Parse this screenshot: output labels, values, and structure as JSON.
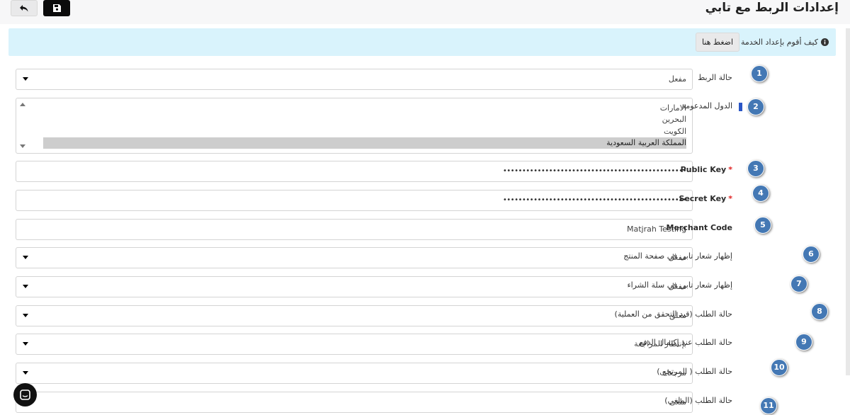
{
  "header": {
    "title": "إعدادات الربط مع تابي",
    "back_icon": "undo-arrow-icon",
    "save_icon": "floppy-disk-icon"
  },
  "info": {
    "text": "كيف أقوم بإعداد الخدمة ؟",
    "button_label": "اضغط هنا",
    "icon": "info-circle-icon"
  },
  "fields": {
    "link_status": {
      "label": "حالة الربط",
      "value": "مفعل",
      "badge": "1"
    },
    "countries": {
      "label": "الدول المدعومة",
      "badge": "2",
      "options": [
        "الامارات",
        "البحرين",
        "الكويت",
        "المملكة العربية السعودية"
      ],
      "selected": "المملكة العربية السعودية"
    },
    "public_key": {
      "label": "Public Key",
      "required": "*",
      "value": "••••••••••••••••••••••••••••••••••••••••••••••••",
      "badge": "3"
    },
    "secret_key": {
      "label": "Secret Key",
      "required": "*",
      "value": "••••••••••••••••••••••••••••••••••••••••••••••••",
      "badge": "4"
    },
    "merchant_code": {
      "label": "Merchant Code",
      "value": "Matjrah Testing",
      "badge": "5"
    },
    "logo_product": {
      "label": "إظهار شعار تابي في صفحة المنتج",
      "value": "مفعل",
      "badge": "6"
    },
    "logo_cart": {
      "label": "إظهار شعار تابي في سلة الشراء",
      "value": "مفعل",
      "badge": "7"
    },
    "status_pending": {
      "label": "حالة الطلب (قيد التحقق من العملية)",
      "value": "معلق",
      "badge": "8"
    },
    "status_paid": {
      "label": "حالة الطلب عند إكتمال الدفع",
      "value": "بإنتظار المراجعة",
      "badge": "9"
    },
    "status_refund": {
      "label": "حالة الطلب ( المرتجع )",
      "value": "مرجعات",
      "badge": "10"
    },
    "status_cancel": {
      "label": "حالة الطلب (الملغي)",
      "value": "ملغى",
      "badge": "11"
    }
  },
  "chat": {
    "icon": "chat-bubble-icon"
  },
  "colors": {
    "badge": "#4478b4",
    "info_bg": "#d9f3fc",
    "required": "#e02020"
  }
}
